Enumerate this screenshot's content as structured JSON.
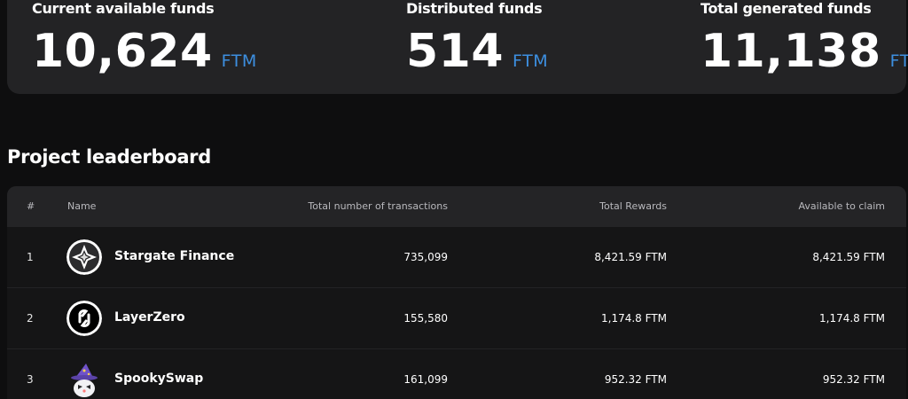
{
  "funds": [
    {
      "label": "Current available funds",
      "value": "10,624",
      "unit": "FTM"
    },
    {
      "label": "Distributed funds",
      "value": "514",
      "unit": "FTM"
    },
    {
      "label": "Total generated funds",
      "value": "11,138",
      "unit": "FTM"
    }
  ],
  "leaderboard": {
    "title": "Project leaderboard",
    "columns": [
      "#",
      "Name",
      "Total number of transactions",
      "Total Rewards",
      "Available to claim"
    ],
    "rows": [
      {
        "rank": "1",
        "name": "Stargate Finance",
        "icon": "stargate-logo-icon",
        "transactions": "735,099",
        "rewards": "8,421.59 FTM",
        "available": "8,421.59 FTM"
      },
      {
        "rank": "2",
        "name": "LayerZero",
        "icon": "layerzero-logo-icon",
        "transactions": "155,580",
        "rewards": "1,174.8 FTM",
        "available": "1,174.8 FTM"
      },
      {
        "rank": "3",
        "name": "SpookySwap",
        "icon": "spookyswap-logo-icon",
        "transactions": "161,099",
        "rewards": "952.32 FTM",
        "available": "952.32 FTM"
      }
    ]
  },
  "colors": {
    "accent": "#3d8fe0",
    "background": "#0e0e0f",
    "card": "#232325"
  }
}
